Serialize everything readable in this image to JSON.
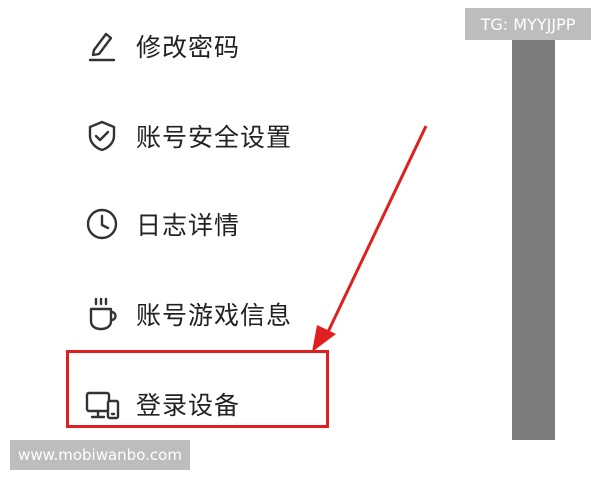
{
  "menu": {
    "items": [
      {
        "label": "修改密码",
        "icon": "pencil-icon"
      },
      {
        "label": "账号安全设置",
        "icon": "shield-check-icon"
      },
      {
        "label": "日志详情",
        "icon": "clock-icon"
      },
      {
        "label": "账号游戏信息",
        "icon": "cup-icon"
      },
      {
        "label": "登录设备",
        "icon": "devices-icon"
      }
    ]
  },
  "watermarks": {
    "tg": "TG: MYYJJPP",
    "site": "www.mobiwanbo.com"
  },
  "colors": {
    "annotation": "#e02020",
    "text": "#222222",
    "scroll_strip": "#7d7d7d"
  }
}
